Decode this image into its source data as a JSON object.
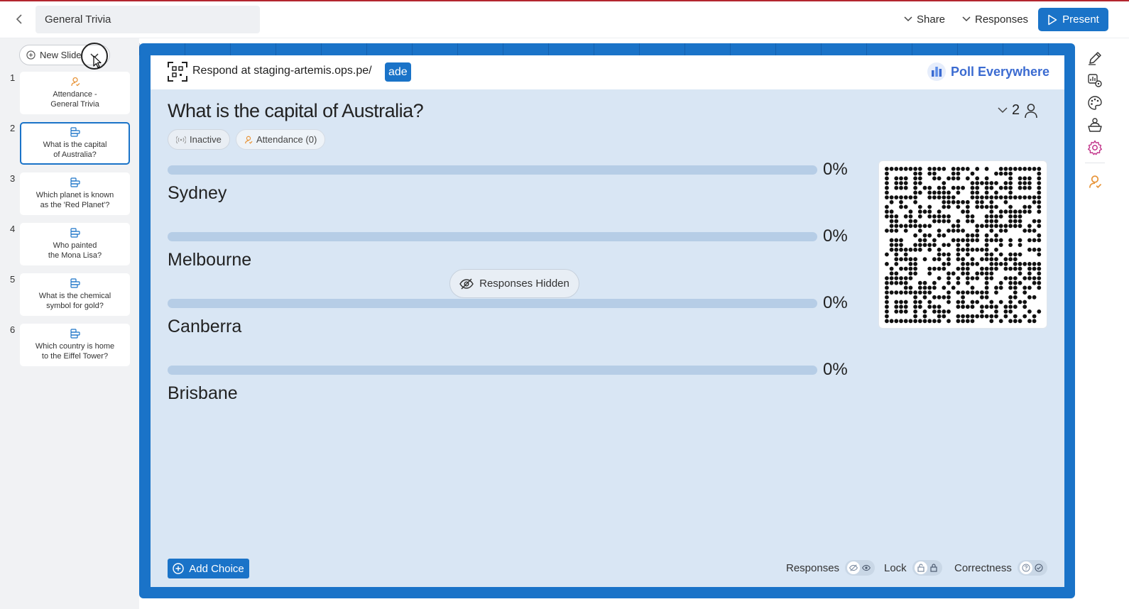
{
  "header": {
    "back_icon": "chevron-left-icon",
    "title_value": "General Trivia",
    "share_label": "Share",
    "responses_label": "Responses",
    "present_label": "Present"
  },
  "sidebar": {
    "new_slide_label": "New Slide",
    "slides": [
      {
        "num": "1",
        "line1": "Attendance -",
        "line2": "General Trivia",
        "icon": "attendance-icon"
      },
      {
        "num": "2",
        "line1": "What is the capital",
        "line2": "of Australia?",
        "icon": "poll-icon"
      },
      {
        "num": "3",
        "line1": "Which planet is known",
        "line2": "as the 'Red Planet'?",
        "icon": "poll-icon"
      },
      {
        "num": "4",
        "line1": "Who painted",
        "line2": "the Mona Lisa?",
        "icon": "poll-icon"
      },
      {
        "num": "5",
        "line1": "What is the chemical",
        "line2": "symbol for gold?",
        "icon": "poll-icon"
      },
      {
        "num": "6",
        "line1": "Which country is home",
        "line2": "to the Eiffel Tower?",
        "icon": "poll-icon"
      }
    ]
  },
  "slide": {
    "respond_text": "Respond at staging-artemis.ops.pe/",
    "respond_code": "ade",
    "brand": "Poll Everywhere",
    "question": "What is the capital of Australia?",
    "participant_count": "2",
    "status_pill": "Inactive",
    "attendance_pill": "Attendance (0)",
    "choices": [
      {
        "label": "Sydney",
        "percent": "0%",
        "fraction": 0
      },
      {
        "label": "Melbourne",
        "percent": "0%",
        "fraction": 0
      },
      {
        "label": "Canberra",
        "percent": "0%",
        "fraction": 0
      },
      {
        "label": "Brisbane",
        "percent": "0%",
        "fraction": 0
      }
    ],
    "responses_hidden_label": "Responses Hidden",
    "add_choice_label": "Add Choice",
    "toggles": {
      "responses_label": "Responses",
      "lock_label": "Lock",
      "correctness_label": "Correctness"
    }
  },
  "colors": {
    "accent": "#1a73c8",
    "canvas": "#d9e6f4",
    "attendance_orange": "#e8953a",
    "settings_pink": "#c2338a"
  }
}
